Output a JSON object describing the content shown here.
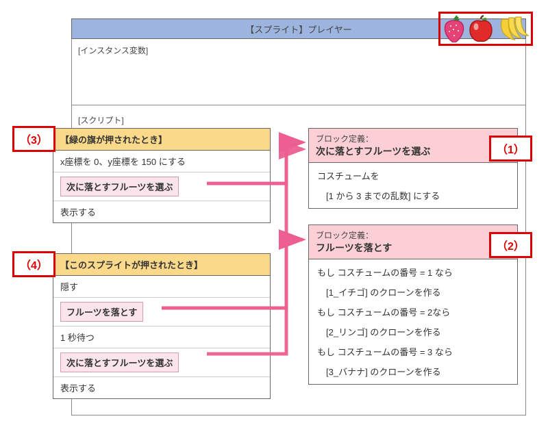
{
  "title": "【スプライト】プレイヤー",
  "sections": {
    "ivars": "[インスタンス変数]",
    "scripts": "[スクリプト]"
  },
  "callouts": {
    "c1": "（1）",
    "c2": "（2）",
    "c3": "（3）",
    "c4": "（4）"
  },
  "script3": {
    "header": "【緑の旗が押されたとき】",
    "r1": "x座標を 0、y座標を 150 にする",
    "r2": "次に落とすフルーツを選ぶ",
    "r3": "表示する"
  },
  "script4": {
    "header": "【このスプライトが押されたとき】",
    "r1": "隠す",
    "r2": "フルーツを落とす",
    "r3": "1 秒待つ",
    "r4": "次に落とすフルーツを選ぶ",
    "r5": "表示する"
  },
  "def1": {
    "label": "ブロック定義：",
    "name": "次に落とすフルーツを選ぶ",
    "b1": "コスチュームを",
    "b2": "　[1 から 3 までの乱数] にする"
  },
  "def2": {
    "label": "ブロック定義：",
    "name": "フルーツを落とす",
    "b1": "もし コスチュームの番号 = 1 なら",
    "b2": "　[1_イチゴ] のクローンを作る",
    "b3": "もし コスチュームの番号 = 2なら",
    "b4": "　[2_リンゴ] のクローンを作る",
    "b5": "もし コスチュームの番号 = 3 なら",
    "b6": "　[3_バナナ] のクローンを作る"
  },
  "fruits": {
    "strawberry": "strawberry-icon",
    "apple": "apple-icon",
    "banana": "banana-icon"
  }
}
